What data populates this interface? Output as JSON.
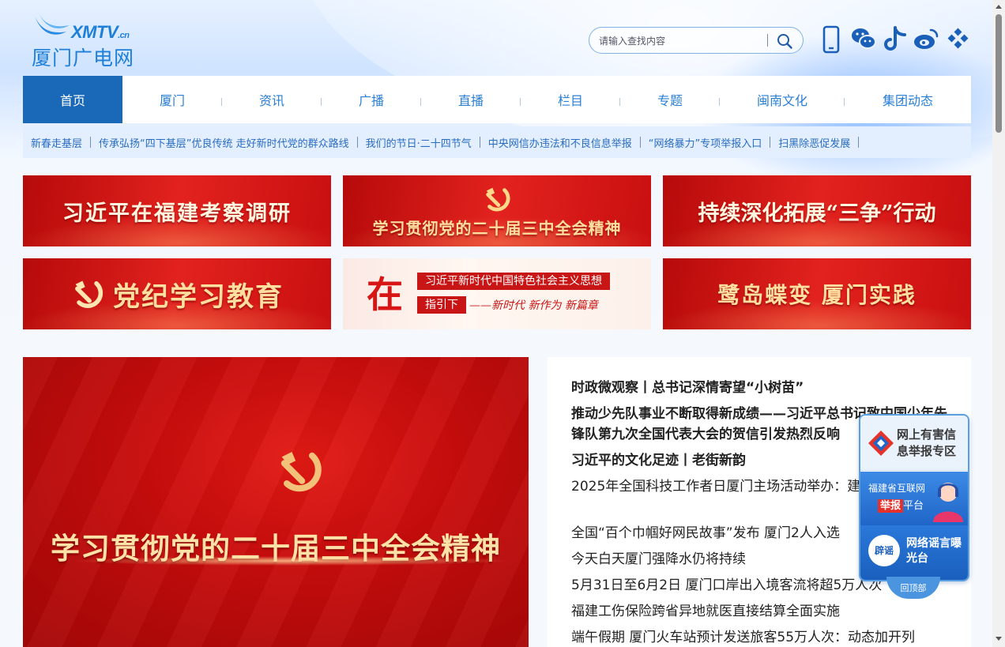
{
  "header": {
    "logo_en": "XMTV",
    "logo_en_suffix": ".cn",
    "logo_cn": "厦门广电网",
    "search_placeholder": "请输入查找内容"
  },
  "nav": {
    "items": [
      {
        "label": "首页",
        "active": true
      },
      {
        "label": "厦门"
      },
      {
        "label": "资讯"
      },
      {
        "label": "广播"
      },
      {
        "label": "直播"
      },
      {
        "label": "栏目"
      },
      {
        "label": "专题"
      },
      {
        "label": "闽南文化"
      },
      {
        "label": "集团动态"
      }
    ]
  },
  "subnav": {
    "links": [
      "新春走基层",
      "传承弘扬“四下基层”优良传统 走好新时代党的群众路线",
      "我们的节日·二十四节气",
      "中央网信办违法和不良信息举报",
      "“网络暴力”专项举报入口",
      "扫黑除恶促发展"
    ]
  },
  "banners": {
    "b1": "习近平在福建考察调研",
    "b2": "学习贯彻党的二十届三中全会精神",
    "b3": "持续深化拓展“三争”行动",
    "b4": "党纪学习教育",
    "b5_big": "在",
    "b5_line1": "习近平新时代中国特色社会主义思想",
    "b5_line2": "指引下",
    "b5_line3": "——新时代 新作为 新篇章",
    "b6": "鹭岛蝶变 厦门实践"
  },
  "hero": {
    "title": "学习贯彻党的二十届三中全会精神"
  },
  "news": {
    "items": [
      "时政微观察丨总书记深情寄望“小树苗”",
      "推动少先队事业不断取得新成绩——习近平总书记致中国少年先锋队第九次全国代表大会的贺信引发热烈反响",
      "习近平的文化足迹丨老街新韵",
      "2025年全国科技工作者日厦门主场活动举办：建设科技强市",
      "全国“百个巾帼好网民故事”发布 厦门2人入选",
      "今天白天厦门强降水仍将持续",
      "5月31日至6月2日 厦门口岸出入境客流将超5万人次",
      "福建工伤保险跨省异地就医直接结算全面实施",
      "端午假期 厦门火车站预计发送旅客55万人次：动态加开列"
    ]
  },
  "float": {
    "report_title": "网上有害信息举报专区",
    "platform_line1": "福建省互联网",
    "platform_report": "举报",
    "platform_suffix": "平台",
    "rumor_icon": "辟谣",
    "rumor_title": "网络谣言曝光台",
    "back_top": "回顶部"
  },
  "colors": {
    "brand_blue": "#1a68b8",
    "link_blue": "#2a7fd4",
    "banner_red": "#d11a16",
    "gold": "#fde2a8"
  },
  "icons": [
    "search-icon",
    "mobile-icon",
    "wechat-icon",
    "douyin-icon",
    "weibo-icon",
    "app-grid-icon",
    "party-emblem-icon"
  ]
}
